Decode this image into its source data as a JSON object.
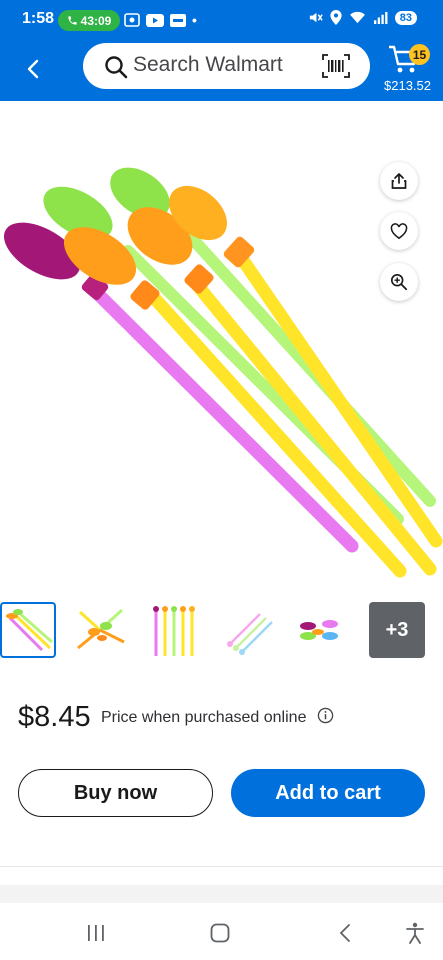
{
  "status_bar": {
    "time": "1:58",
    "call_timer": "43:09",
    "battery": "83"
  },
  "header": {
    "search_placeholder": "Search Walmart",
    "cart_count": "15",
    "cart_total": "$213.52"
  },
  "gallery": {
    "thumbnails": [
      "product-main-view",
      "product-fan-view",
      "product-row-view",
      "product-pastel-view",
      "product-spoons-view"
    ],
    "more_label": "+3"
  },
  "pricing": {
    "price": "$8.45",
    "note": "Price when purchased online"
  },
  "actions": {
    "buy_now": "Buy now",
    "add_to_cart": "Add to cart"
  },
  "colors": {
    "brand_blue": "#0071dc",
    "cart_badge": "#ffc220",
    "call_green": "#2fb344"
  },
  "icons": [
    "back-icon",
    "search-icon",
    "barcode-icon",
    "cart-icon",
    "share-icon",
    "heart-icon",
    "zoom-icon",
    "info-icon",
    "recent-apps-icon",
    "home-icon",
    "nav-back-icon",
    "accessibility-icon"
  ]
}
